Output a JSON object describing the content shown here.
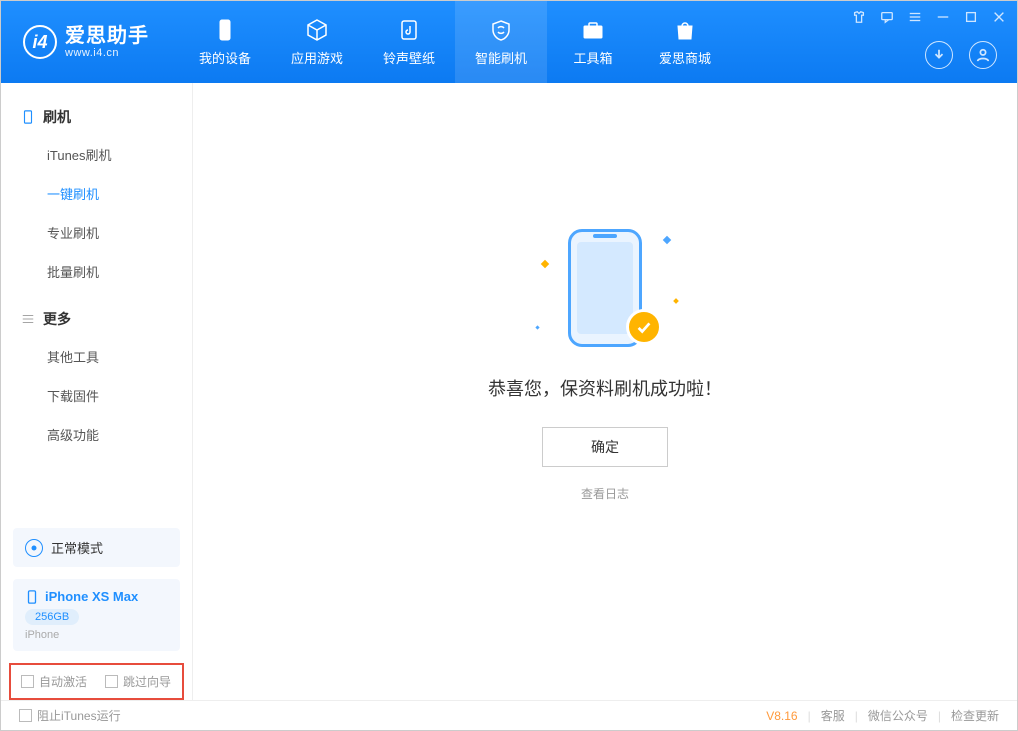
{
  "app": {
    "title": "爱思助手",
    "subtitle": "www.i4.cn"
  },
  "nav": {
    "items": [
      {
        "label": "我的设备"
      },
      {
        "label": "应用游戏"
      },
      {
        "label": "铃声壁纸"
      },
      {
        "label": "智能刷机"
      },
      {
        "label": "工具箱"
      },
      {
        "label": "爱思商城"
      }
    ]
  },
  "sidebar": {
    "group1": {
      "header": "刷机",
      "items": [
        {
          "label": "iTunes刷机"
        },
        {
          "label": "一键刷机"
        },
        {
          "label": "专业刷机"
        },
        {
          "label": "批量刷机"
        }
      ]
    },
    "group2": {
      "header": "更多",
      "items": [
        {
          "label": "其他工具"
        },
        {
          "label": "下载固件"
        },
        {
          "label": "高级功能"
        }
      ]
    },
    "mode": {
      "label": "正常模式"
    },
    "device": {
      "name": "iPhone XS Max",
      "storage": "256GB",
      "type": "iPhone"
    },
    "checks": {
      "auto_activate": "自动激活",
      "skip_guide": "跳过向导"
    }
  },
  "main": {
    "success_message": "恭喜您，保资料刷机成功啦！",
    "ok_button": "确定",
    "view_log": "查看日志"
  },
  "footer": {
    "block_itunes": "阻止iTunes运行",
    "version": "V8.16",
    "links": {
      "support": "客服",
      "wechat": "微信公众号",
      "update": "检查更新"
    }
  }
}
